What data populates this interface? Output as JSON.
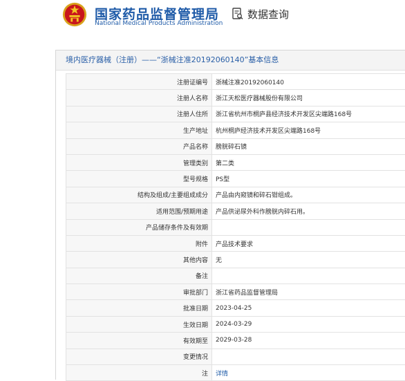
{
  "header": {
    "site_title": "国家药品监督管理局",
    "site_subtitle": "National Medical Products Administration",
    "query_label": "数据查询"
  },
  "panel": {
    "title": "境内医疗器械（注册）——“浙械注准20192060140”基本信息"
  },
  "rows": [
    {
      "label": "注册证编号",
      "value": "浙械注准20192060140"
    },
    {
      "label": "注册人名称",
      "value": "浙江天松医疗器械股份有限公司"
    },
    {
      "label": "注册人住所",
      "value": "浙江省杭州市桐庐县经济技术开发区尖端路168号"
    },
    {
      "label": "生产地址",
      "value": "杭州桐庐经济技术开发区尖端路168号"
    },
    {
      "label": "产品名称",
      "value": "膀胱碎石镜"
    },
    {
      "label": "管理类别",
      "value": "第二类"
    },
    {
      "label": "型号规格",
      "value": "PS型"
    },
    {
      "label": "结构及组成/主要组成成分",
      "value": "产品由内窥镜和碎石钳组成。"
    },
    {
      "label": "适用范围/预期用途",
      "value": "产品供泌尿外科作膀胱内碎石用。"
    },
    {
      "label": "产品储存条件及有效期",
      "value": ""
    },
    {
      "label": "附件",
      "value": "产品技术要求"
    },
    {
      "label": "其他内容",
      "value": "无"
    },
    {
      "label": "备注",
      "value": ""
    },
    {
      "label": "审批部门",
      "value": "浙江省药品监督管理局"
    },
    {
      "label": "批准日期",
      "value": "2023-04-25"
    },
    {
      "label": "生效日期",
      "value": "2024-03-29"
    },
    {
      "label": "有效期至",
      "value": "2029-03-28"
    },
    {
      "label": "变更情况",
      "value": ""
    },
    {
      "label": "注",
      "value": "详情"
    }
  ]
}
